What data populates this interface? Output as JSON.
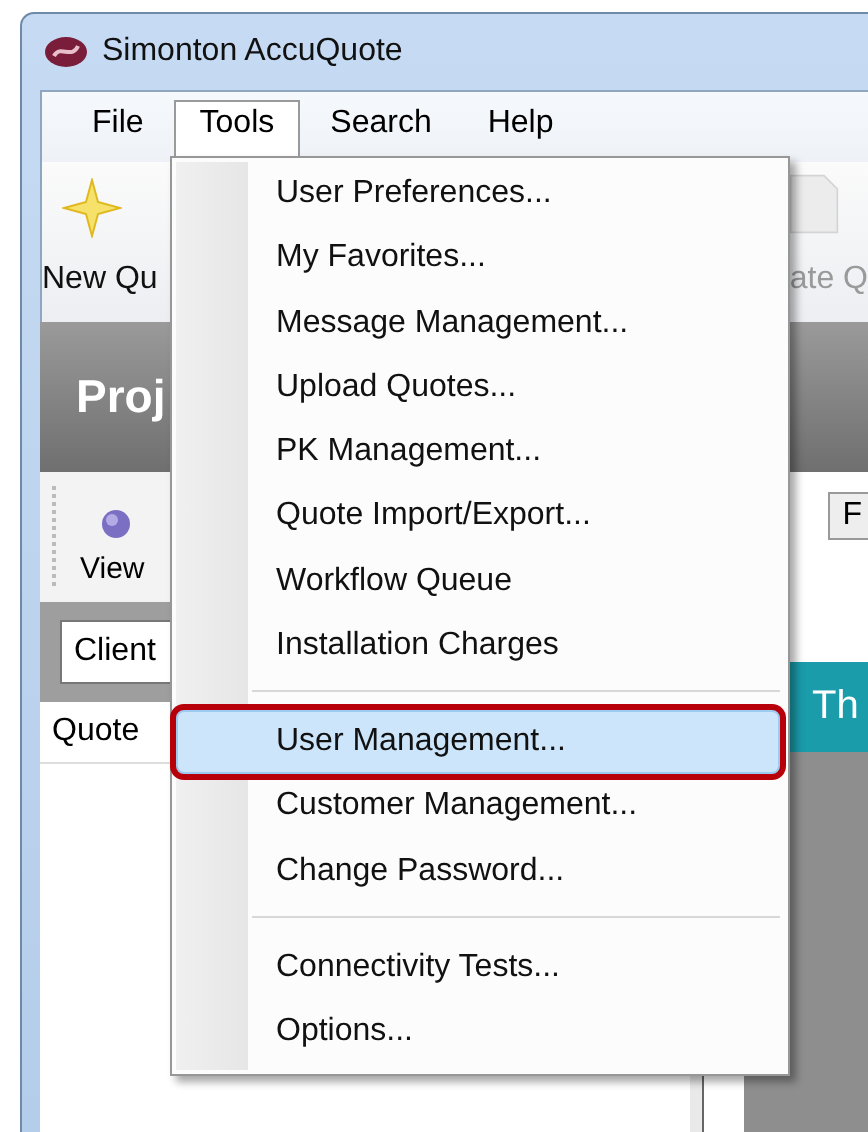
{
  "window": {
    "title": "Simonton AccuQuote"
  },
  "menu_bar": [
    {
      "label": "File",
      "selected": false
    },
    {
      "label": "Tools",
      "selected": true
    },
    {
      "label": "Search",
      "selected": false
    },
    {
      "label": "Help",
      "selected": false
    }
  ],
  "toolbar": [
    {
      "label": "New Qu",
      "disabled": false
    },
    {
      "label": "ate Q",
      "disabled": true
    }
  ],
  "header": {
    "title": "Proj"
  },
  "left_panel": {
    "toolbar_button": "View",
    "field": {
      "value": "Client"
    },
    "column": "Quote"
  },
  "right_panel": {
    "button": "F",
    "banner": "Th"
  },
  "tools_menu": {
    "groups": [
      [
        {
          "label": "User Preferences...",
          "selected": false
        },
        {
          "label": "My Favorites...",
          "selected": false
        },
        {
          "label": "Message Management...",
          "selected": false
        },
        {
          "label": "Upload Quotes...",
          "selected": false
        },
        {
          "label": "PK Management...",
          "selected": false
        },
        {
          "label": "Quote Import/Export...",
          "selected": false
        },
        {
          "label": "Workflow Queue",
          "selected": false
        },
        {
          "label": "Installation Charges",
          "selected": false
        }
      ],
      [
        {
          "label": "User Management...",
          "selected": true
        },
        {
          "label": "Customer Management...",
          "selected": false
        },
        {
          "label": "Change Password...",
          "selected": false
        }
      ],
      [
        {
          "label": "Connectivity Tests...",
          "selected": false
        },
        {
          "label": "Options...",
          "selected": false
        }
      ]
    ]
  }
}
